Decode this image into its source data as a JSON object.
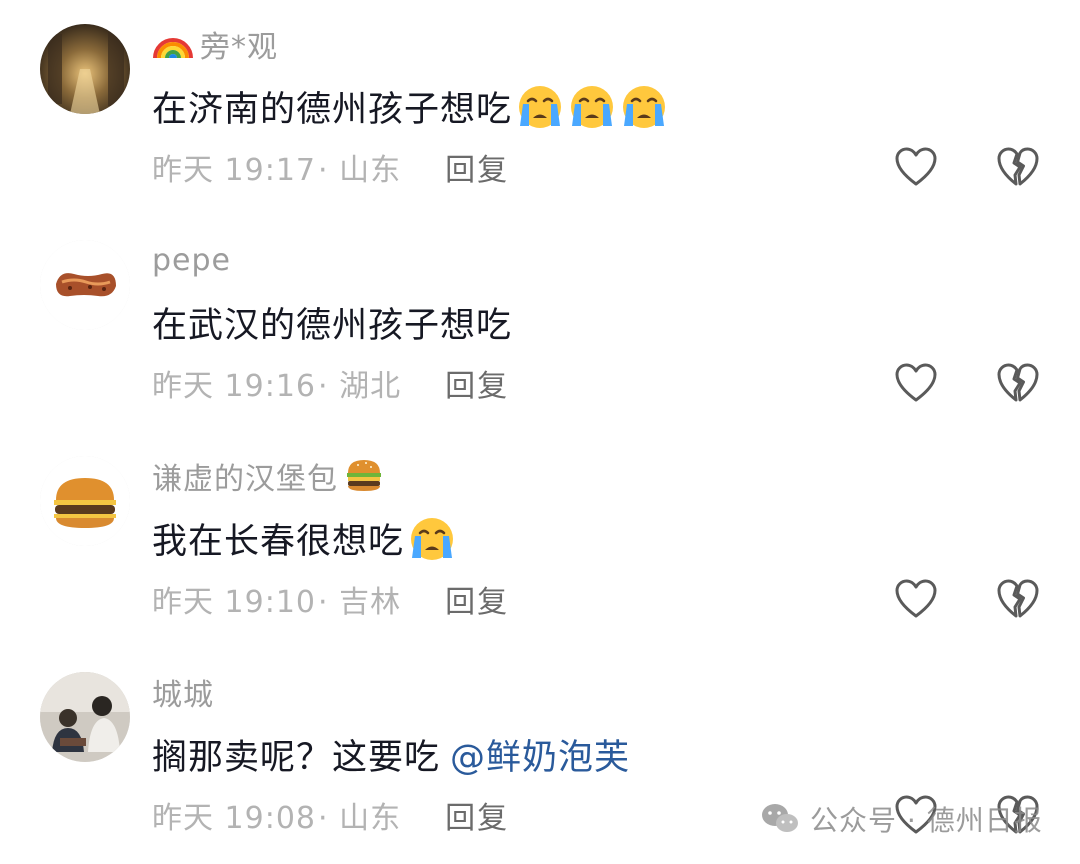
{
  "comments": [
    {
      "username": "旁*观",
      "name_prefix_icon": "rainbow-emoji",
      "text": "在济南的德州孩子想吃",
      "trailing_emojis": [
        "loudly-crying-face-emoji",
        "loudly-crying-face-emoji",
        "loudly-crying-face-emoji"
      ],
      "time": "昨天 19:17",
      "location": "· 山东",
      "reply_label": "回复",
      "avatar": "night-street-photo"
    },
    {
      "username": "pepe",
      "text": "在武汉的德州孩子想吃",
      "time": "昨天 19:16",
      "location": "· 湖北",
      "reply_label": "回复",
      "avatar": "grilled-sausage-photo"
    },
    {
      "username": "谦虚的汉堡包",
      "name_suffix_icon": "hamburger-emoji",
      "text": "我在长春很想吃",
      "trailing_emojis": [
        "loudly-crying-face-emoji"
      ],
      "time": "昨天 19:10",
      "location": "· 吉林",
      "reply_label": "回复",
      "avatar": "hamburger-photo"
    },
    {
      "username": "城城",
      "text": "搁那卖呢？这要吃",
      "mention": "@鲜奶泡芙",
      "time": "昨天 19:08",
      "location": "· 山东",
      "reply_label": "回复",
      "avatar": "people-photo"
    }
  ],
  "actions": {
    "like_icon": "heart-outline-icon",
    "dislike_icon": "broken-heart-icon"
  },
  "watermark": {
    "icon": "wechat-icon",
    "text": "公众号 · 德州日报"
  },
  "colors": {
    "text": "#161823",
    "muted": "#b3b3b3",
    "username": "#9c9c9c",
    "mention": "#2a5a9b"
  }
}
